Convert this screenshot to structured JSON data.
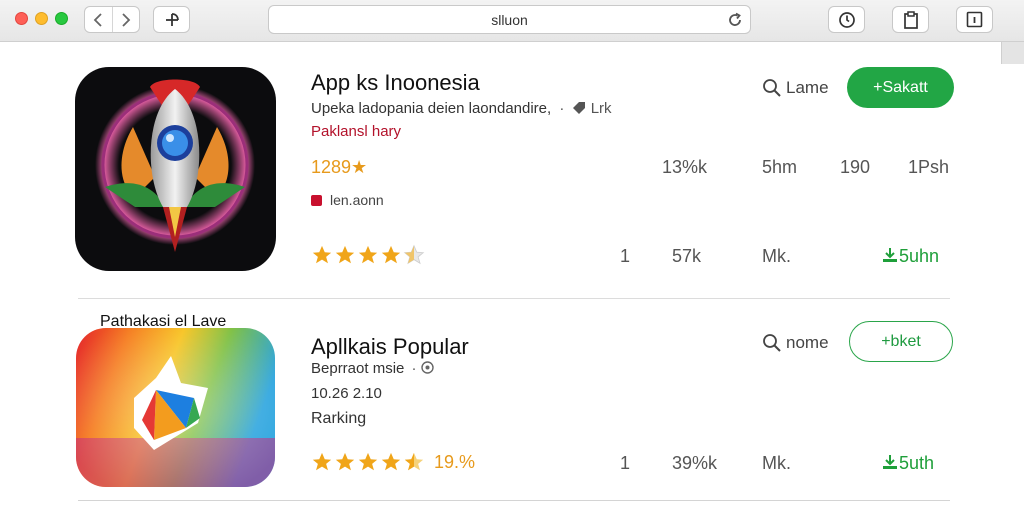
{
  "toolbar": {
    "address_text": "slluon"
  },
  "apps": [
    {
      "title": "App ks Inoonesia",
      "subtitle": "Upeka ladopania deien laondandire,",
      "tag": "Lrk",
      "category": "Paklansl hary",
      "rating_text": "1289★",
      "badge_text": "len.aonn",
      "stats_row1": [
        "13%k",
        "5hm",
        "190",
        "1Psh"
      ],
      "stats_row2": [
        "1",
        "57k",
        "Mk."
      ],
      "download_text": "5uhn",
      "search_label": "Lame",
      "action_label": "+Sakatt",
      "stars": 4
    },
    {
      "overlay_text": "Pathakasi el Lave",
      "title": "Apllkais Popular",
      "subtitle": "Beprraot msie",
      "version": "10.26 2.10",
      "ranking": "Rarking",
      "rating_percent": "19.%",
      "stats_row2": [
        "1",
        "39%k",
        "Mk."
      ],
      "download_text": "5uth",
      "search_label": "nome",
      "action_label": "+bket",
      "stars": 4.5
    }
  ],
  "colors": {
    "accent_green": "#22a645",
    "rating_orange": "#e79a1c",
    "category_red": "#b3122b"
  }
}
